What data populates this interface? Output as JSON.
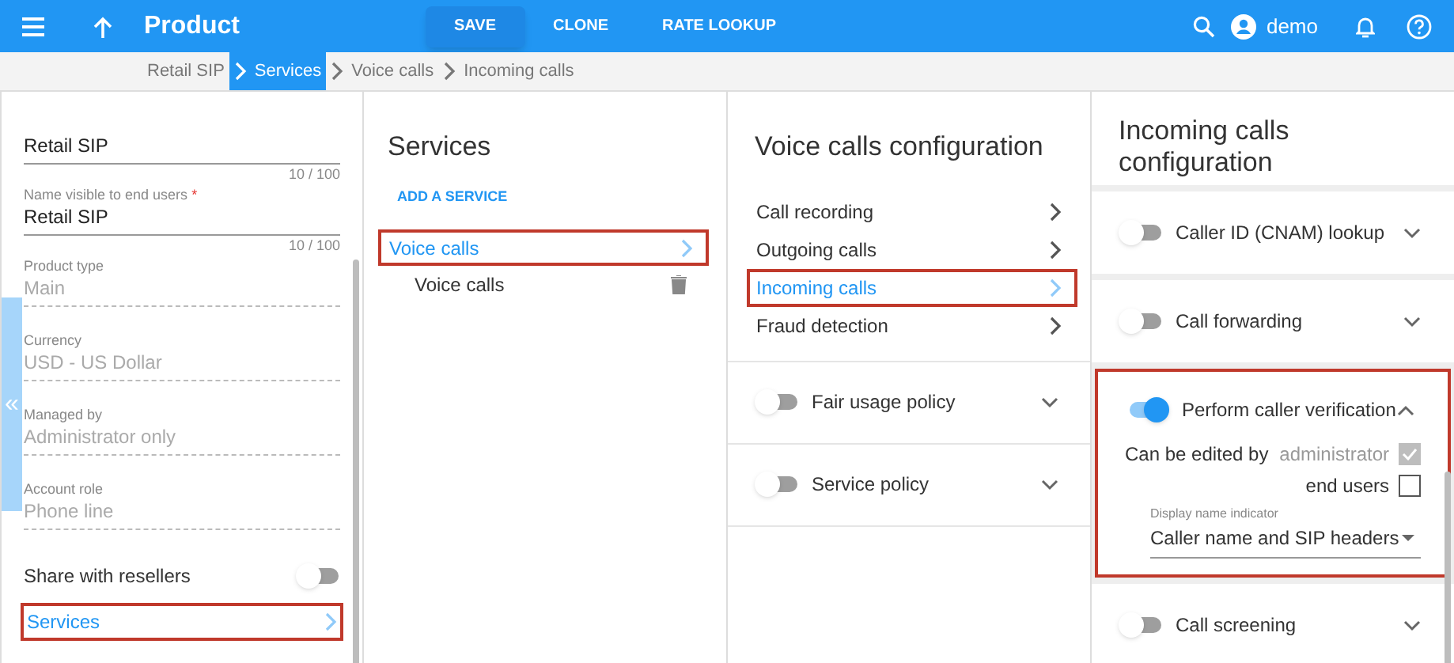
{
  "header": {
    "title": "Product",
    "actions": [
      {
        "label": "SAVE",
        "primary": true
      },
      {
        "label": "CLONE",
        "primary": false
      },
      {
        "label": "RATE LOOKUP",
        "primary": false
      }
    ],
    "user": "demo"
  },
  "breadcrumb": [
    {
      "label": "Retail SIP",
      "selected": false
    },
    {
      "label": "Services",
      "selected": true
    },
    {
      "label": "Voice calls",
      "selected": false
    },
    {
      "label": "Incoming calls",
      "selected": false
    }
  ],
  "product_panel": {
    "fields": [
      {
        "kind": "input",
        "value": "Retail SIP",
        "counter": "10 / 100"
      },
      {
        "kind": "input",
        "label": "Name visible to end users",
        "required_mark": "*",
        "value": "Retail SIP",
        "counter": "10 / 100"
      },
      {
        "kind": "readonly",
        "label": "Product type",
        "value": "Main"
      },
      {
        "kind": "readonly",
        "label": "Currency",
        "value": "USD - US Dollar"
      },
      {
        "kind": "readonly",
        "label": "Managed by",
        "value": "Administrator only"
      },
      {
        "kind": "readonly",
        "label": "Account role",
        "value": "Phone line"
      }
    ],
    "share": {
      "label": "Share with resellers",
      "on": false
    },
    "nav": {
      "label": "Services",
      "highlighted": true
    },
    "collapse_tab": "«"
  },
  "services_panel": {
    "title": "Services",
    "add_label": "ADD A SERVICE",
    "items": [
      {
        "label": "Voice calls",
        "selected": true,
        "highlighted": true,
        "children": [
          {
            "label": "Voice calls"
          }
        ]
      }
    ]
  },
  "voice_panel": {
    "title": "Voice calls configuration",
    "links": [
      {
        "label": "Call recording",
        "selected": false,
        "highlighted": false
      },
      {
        "label": "Outgoing calls",
        "selected": false,
        "highlighted": false
      },
      {
        "label": "Incoming calls",
        "selected": true,
        "highlighted": true
      },
      {
        "label": "Fraud detection",
        "selected": false,
        "highlighted": false
      }
    ],
    "sections": [
      {
        "label": "Fair usage policy",
        "on": false,
        "expanded": false
      },
      {
        "label": "Service policy",
        "on": false,
        "expanded": false
      }
    ]
  },
  "incoming_panel": {
    "title": "Incoming calls configuration",
    "sections": [
      {
        "label": "Caller ID (CNAM) lookup",
        "on": false,
        "expanded": false,
        "highlighted": false
      },
      {
        "label": "Call forwarding",
        "on": false,
        "expanded": false,
        "highlighted": false
      },
      {
        "label": "Perform caller verification",
        "on": true,
        "expanded": true,
        "highlighted": true,
        "editable_label": "Can be edited by",
        "editors": [
          {
            "label": "administrator",
            "checked": true,
            "disabled": true
          },
          {
            "label": "end users",
            "checked": false,
            "disabled": false
          }
        ],
        "select": {
          "label": "Display name indicator",
          "value": "Caller name and SIP headers"
        }
      },
      {
        "label": "Call screening",
        "on": false,
        "expanded": false,
        "highlighted": false
      }
    ]
  }
}
